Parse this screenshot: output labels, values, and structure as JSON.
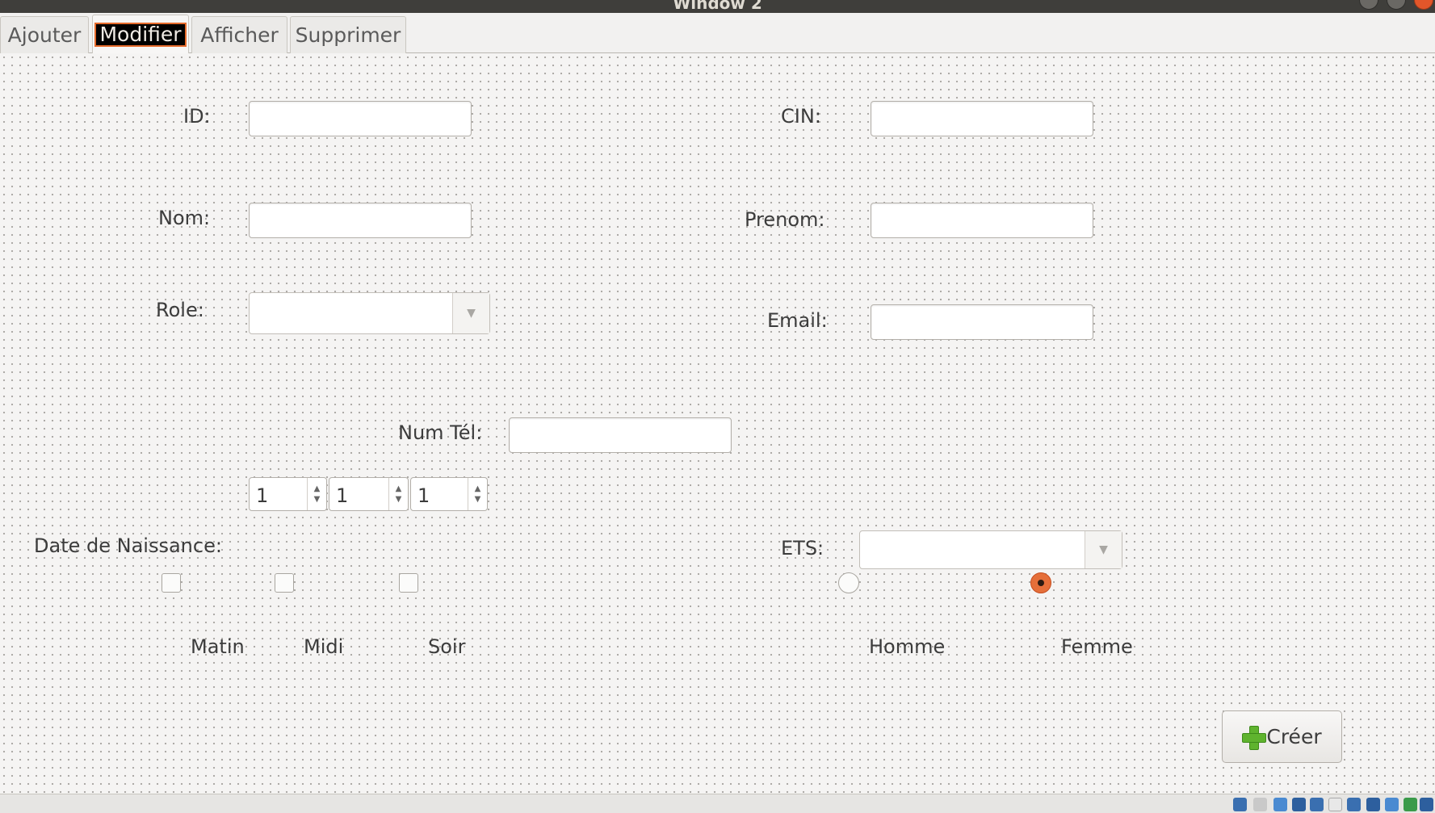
{
  "window": {
    "title": "Window 2"
  },
  "tabs": [
    {
      "label": "Ajouter"
    },
    {
      "label": "Modifier",
      "active": true
    },
    {
      "label": "Afficher"
    },
    {
      "label": "Supprimer"
    }
  ],
  "form": {
    "id_label": "ID:",
    "id_value": "",
    "cin_label": "CIN:",
    "cin_value": "",
    "nom_label": "Nom:",
    "nom_value": "",
    "prenom_label": "Prenom:",
    "prenom_value": "",
    "role_label": "Role:",
    "role_value": "",
    "email_label": "Email:",
    "email_value": "",
    "numtel_label": "Num Tél:",
    "numtel_value": "",
    "date_label": "Date de Naissance:",
    "date_day": "1",
    "date_month": "1",
    "date_year": "1",
    "ets_label": "ETS:",
    "ets_value": "",
    "shifts": [
      {
        "label": "Matin",
        "checked": false
      },
      {
        "label": "Midi",
        "checked": false
      },
      {
        "label": "Soir",
        "checked": false
      }
    ],
    "gender": [
      {
        "label": "Homme",
        "selected": false
      },
      {
        "label": "Femme",
        "selected": true
      }
    ],
    "submit_label": "Créer",
    "submit_icon": "plus-icon"
  },
  "colors": {
    "accent": "#e56f3a",
    "add_icon_green": "#5fb32e",
    "titlebar": "#3f3e3b"
  }
}
